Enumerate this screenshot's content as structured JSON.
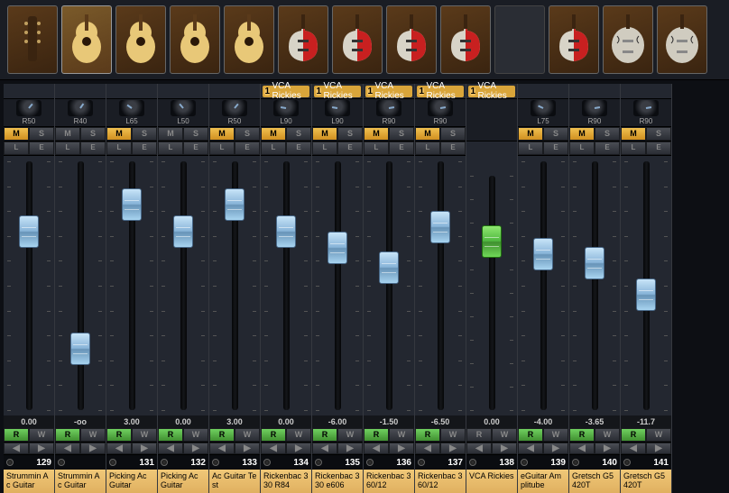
{
  "thumbs": [
    {
      "kind": "headstock"
    },
    {
      "kind": "acoustic",
      "sel": true
    },
    {
      "kind": "acoustic"
    },
    {
      "kind": "acoustic"
    },
    {
      "kind": "acoustic"
    },
    {
      "kind": "rick"
    },
    {
      "kind": "rick"
    },
    {
      "kind": "rick"
    },
    {
      "kind": "rick"
    },
    {
      "kind": "empty"
    },
    {
      "kind": "rick"
    },
    {
      "kind": "gretsch"
    },
    {
      "kind": "gretsch"
    }
  ],
  "vca_label": "VCA Rickies",
  "vca_num": "1",
  "channels": [
    {
      "pan": "R50",
      "knob": 40,
      "m": true,
      "db": "0.00",
      "r": true,
      "fader": 60,
      "num": "129",
      "name": "Strummin Ac Guitar",
      "vca": false,
      "cap": "blue"
    },
    {
      "pan": "R40",
      "knob": 35,
      "m": false,
      "db": "-oo",
      "r": true,
      "fader": 190,
      "num": "",
      "name": "Strummin Ac Guitar",
      "vca": false,
      "cap": "blue"
    },
    {
      "pan": "L65",
      "knob": -55,
      "m": true,
      "db": "3.00",
      "r": true,
      "fader": 30,
      "num": "131",
      "name": "Picking Ac Guitar",
      "vca": false,
      "cap": "blue"
    },
    {
      "pan": "L50",
      "knob": -40,
      "m": false,
      "db": "0.00",
      "r": true,
      "fader": 60,
      "num": "132",
      "name": "Picking Ac Guitar",
      "vca": false,
      "cap": "blue"
    },
    {
      "pan": "R50",
      "knob": 40,
      "m": true,
      "db": "3.00",
      "r": true,
      "fader": 30,
      "num": "133",
      "name": "Ac Guitar Test",
      "vca": false,
      "cap": "blue"
    },
    {
      "pan": "L90",
      "knob": -80,
      "m": true,
      "db": "0.00",
      "r": true,
      "fader": 60,
      "num": "134",
      "name": "Rickenbac 330 R84",
      "vca": true,
      "cap": "blue"
    },
    {
      "pan": "L90",
      "knob": -80,
      "m": true,
      "db": "-6.00",
      "r": true,
      "fader": 78,
      "num": "135",
      "name": "Rickenbac 330 e606",
      "vca": true,
      "cap": "blue"
    },
    {
      "pan": "R90",
      "knob": 80,
      "m": true,
      "db": "-1.50",
      "r": true,
      "fader": 100,
      "num": "136",
      "name": "Rickenbac 360/12",
      "vca": true,
      "cap": "blue"
    },
    {
      "pan": "R90",
      "knob": 80,
      "m": true,
      "db": "-6.50",
      "r": true,
      "fader": 55,
      "num": "137",
      "name": "Rickenbac 360/12",
      "vca": true,
      "cap": "blue"
    },
    {
      "pan": "",
      "knob": 0,
      "m": false,
      "db": "0.00",
      "r": false,
      "fader": 55,
      "num": "138",
      "name": "VCA Rickies",
      "vca_full": true,
      "cap": "green",
      "hidems": true
    },
    {
      "pan": "L75",
      "knob": -65,
      "m": true,
      "db": "-4.00",
      "r": true,
      "fader": 85,
      "num": "139",
      "name": "eGuitar Amplitube",
      "vca": false,
      "cap": "blue"
    },
    {
      "pan": "R90",
      "knob": 80,
      "m": true,
      "db": "-3.65",
      "r": true,
      "fader": 95,
      "num": "140",
      "name": "Gretsch G5420T",
      "vca": false,
      "cap": "blue"
    },
    {
      "pan": "R90",
      "knob": 80,
      "m": true,
      "db": "-11.7",
      "r": true,
      "fader": 130,
      "num": "141",
      "name": "Gretsch G5420T",
      "vca": false,
      "cap": "blue"
    }
  ],
  "btn_labels": {
    "m": "M",
    "s": "S",
    "l": "L",
    "e": "E",
    "r": "R",
    "w": "W",
    "left": "◀",
    "right": "▶"
  }
}
